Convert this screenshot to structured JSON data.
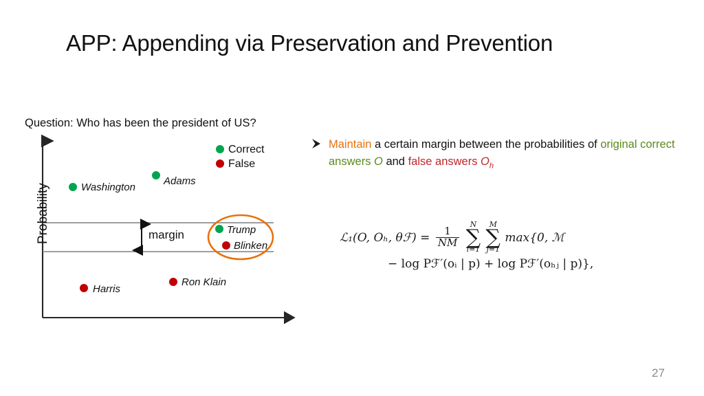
{
  "slide": {
    "title": "APP: Appending via Preservation and Prevention",
    "page_number": "27"
  },
  "chart_panel": {
    "question": "Question: Who has been the president of US?",
    "y_axis_title": "Probability",
    "margin_label": "margin",
    "legend": [
      {
        "label": "Correct",
        "color": "#00A550"
      },
      {
        "label": "False",
        "color": "#C00000"
      }
    ],
    "ellipse_color": "#E8710A",
    "axis_color": "#262626",
    "margin_line_color": "#7f7f7f"
  },
  "chart_data": {
    "type": "scatter",
    "title": "Question: Who has been the president of US?",
    "xlabel": "",
    "ylabel": "Probability",
    "grid": false,
    "legend_position": "top-right",
    "annotations": [
      {
        "text": "margin",
        "type": "span-arrow",
        "between": [
          0.62,
          0.46
        ]
      },
      {
        "text": "",
        "type": "ellipse-highlight",
        "encircles": [
          "Trump",
          "Blinken"
        ]
      }
    ],
    "series": [
      {
        "name": "Correct",
        "color": "#00A550",
        "points": [
          {
            "label": "Washington",
            "x": 0.12,
            "y": 0.78
          },
          {
            "label": "Adams",
            "x": 0.46,
            "y": 0.84
          },
          {
            "label": "Trump",
            "x": 0.72,
            "y": 0.6
          }
        ]
      },
      {
        "name": "False",
        "color": "#C00000",
        "points": [
          {
            "label": "Blinken",
            "x": 0.74,
            "y": 0.49
          },
          {
            "label": "Harris",
            "x": 0.17,
            "y": 0.18
          },
          {
            "label": "Ron Klain",
            "x": 0.52,
            "y": 0.21
          }
        ]
      }
    ]
  },
  "bullet": {
    "icon": "arrow-bullet-icon",
    "segments": [
      {
        "text": "Maintain",
        "color": "orange"
      },
      {
        "text": " a certain margin between the probabilities of ",
        "color": "black"
      },
      {
        "text": "original correct answers ",
        "color": "green"
      },
      {
        "text": "O",
        "color": "green",
        "italic": true
      },
      {
        "text": " and ",
        "color": "black"
      },
      {
        "text": "false answers ",
        "color": "red"
      },
      {
        "text": "O",
        "color": "red",
        "italic": true
      },
      {
        "text": "h",
        "color": "red",
        "italic": true,
        "sub": true
      }
    ],
    "plain_text": "Maintain a certain margin between the probabilities of original correct answers O and false answers Oh"
  },
  "formula": {
    "lhs": "ℒ₁(O, Oₕ, θℱ) =",
    "frac_num": "1",
    "frac_den": "NM",
    "sum1_top": "N",
    "sum1_bot": "i=1",
    "sum2_top": "M",
    "sum2_bot": "j=1",
    "max_part": "max{0,  ℳ",
    "line2": "− log Pℱ′(oᵢ | p) + log Pℱ′(oₕⱼ | p)},",
    "plain_text": "L1(O, Oh, thetaF) = (1/NM) sum_{i=1}^{N} sum_{j=1}^{M} max{0, M - log P_{F'}(o_i | p) + log P_{F'}(o_hj | p)},"
  }
}
